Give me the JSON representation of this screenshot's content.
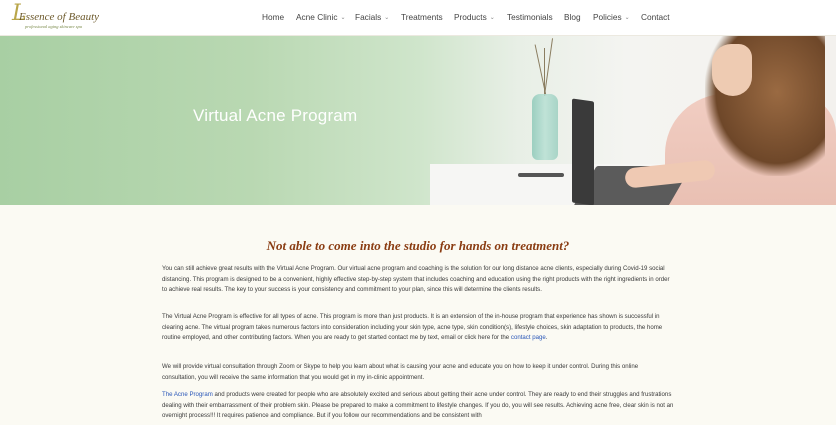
{
  "logo": {
    "script": "L",
    "name": "Essence of Beauty",
    "tagline": "professional aging skincare spa"
  },
  "nav": {
    "items": [
      {
        "label": "Home"
      },
      {
        "label": "Acne Clinic",
        "chevron": "chevron-down-icon"
      },
      {
        "label": "Facials",
        "chevron": "chevron-down-icon"
      },
      {
        "label": "Treatments"
      },
      {
        "label": "Products",
        "chevron": "chevron-down-icon"
      },
      {
        "label": "Testimonials"
      },
      {
        "label": "Blog"
      },
      {
        "label": "Policies",
        "chevron": "chevron-down-icon"
      },
      {
        "label": "Contact"
      }
    ]
  },
  "hero": {
    "title": "Virtual Acne Program"
  },
  "content": {
    "headline": "Not able to come into the studio for hands on treatment?",
    "p1": "You can still achieve great results with the Virtual Acne Program. Our virtual acne program and coaching is the solution for our long distance acne clients, especially during Covid-19 social distancing. This program is designed to be a convenient, highly effective step-by-step system that includes coaching and education using the right products with the right ingredients in order to achieve real results. The key to your success is your consistency and commitment to your plan, since this will determine the clients results.",
    "p2_text": "The Virtual Acne Program is effective for all types of acne. This program is more than just products. It is an extension of the in-house program that experience has shown is successful in clearing acne. The virtual program takes numerous factors into consideration including your skin type, acne type, skin condition(s), lifestyle choices, skin adaptation to products, the home routine employed, and other contributing factors. When you are ready to get started contact me by text, email or click here for the ",
    "p2_link": "contact page",
    "p2_end": ".",
    "p3": "We will provide virtual consultation through Zoom or Skype to help you learn about what is causing your acne and educate you on how to keep it under control. During this online consultation, you will receive the same information that you would get in my in-clinic appointment.",
    "p4_link": "The Acne Program",
    "p4_text": " and products were created for people who are absolutely excited and serious about getting their acne under control. They are ready to end their struggles and frustrations dealing with their embarrassment of their problem skin. Please be prepared to make a commitment to lifestyle changes. If you do, you will see results. Achieving acne free, clear skin is not an overnight process!!! It requires patience and compliance. But if you follow our recommendations and be consistent with"
  },
  "colors": {
    "headline": "#8a3c12",
    "link": "#2a57b8",
    "hero_green": "#a8cfa3"
  }
}
